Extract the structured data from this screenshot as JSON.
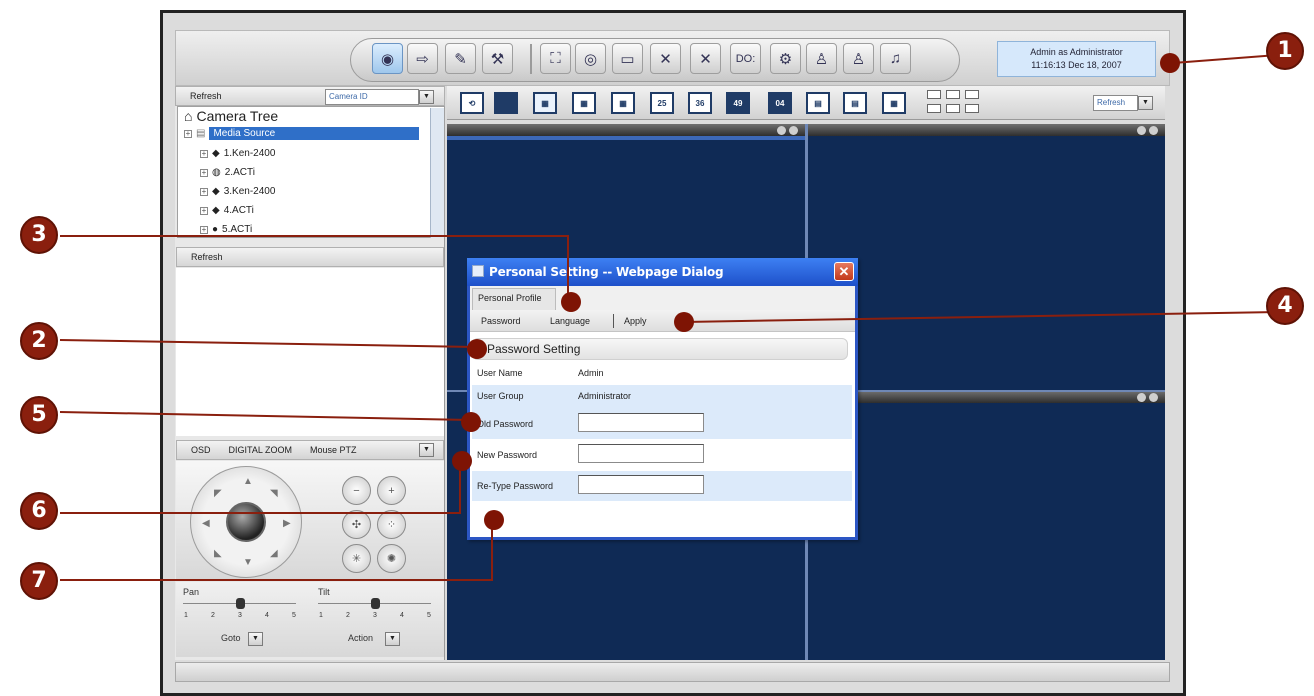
{
  "header": {
    "user_line": "Admin as Administrator",
    "time_line": "11:16:13 Dec 18, 2007",
    "toolbar": [
      {
        "icon": "eye-icon"
      },
      {
        "icon": "export-icon"
      },
      {
        "icon": "route-icon"
      },
      {
        "icon": "tools-icon"
      },
      {
        "icon": "fullscreen-icon"
      },
      {
        "icon": "snapshot-icon"
      },
      {
        "icon": "record-icon"
      },
      {
        "icon": "mute-video-icon"
      },
      {
        "icon": "mute-all-icon"
      },
      {
        "icon": "digital-output-icon",
        "label": "DO:"
      },
      {
        "icon": "settings-icon"
      },
      {
        "icon": "user-icon"
      },
      {
        "icon": "user-settings-icon"
      },
      {
        "icon": "audio-icon"
      }
    ]
  },
  "left": {
    "refresh_label": "Refresh",
    "camera_select": "Camera ID",
    "tree_title": "Camera Tree",
    "media_source": "Media Source",
    "cameras": [
      "1.Ken-2400",
      "2.ACTi",
      "3.Ken-2400",
      "4.ACTi",
      "5.ACTi"
    ],
    "refresh2_label": "Refresh",
    "ptz_tabs": [
      "OSD",
      "DIGITAL ZOOM",
      "Mouse PTZ"
    ],
    "pan_label": "Pan",
    "tilt_label": "Tilt",
    "pan_value": 3,
    "tilt_value": 3,
    "scale": [
      "1",
      "2",
      "3",
      "4",
      "5"
    ],
    "goto_label": "Goto",
    "action_label": "Action"
  },
  "layouts": {
    "buttons": [
      "cycle",
      "1",
      "4",
      "9",
      "16",
      "25",
      "36",
      "49",
      "04",
      "alt-a",
      "alt-b",
      "alt-c"
    ],
    "number_labels": {
      "b25": "25",
      "b36": "36",
      "b49": "49",
      "b04": "04"
    },
    "refresh_select": "Refresh"
  },
  "dialog": {
    "title": "Personal Setting -- Webpage Dialog",
    "tab": "Personal Profile",
    "menu": [
      "Password",
      "Language",
      "Apply"
    ],
    "section": "Password Setting",
    "fields": {
      "user_name_label": "User Name",
      "user_name_value": "Admin",
      "user_group_label": "User Group",
      "user_group_value": "Administrator",
      "old_password_label": "Old Password",
      "new_password_label": "New Password",
      "retype_password_label": "Re-Type Password"
    }
  },
  "callouts": [
    "1",
    "2",
    "3",
    "4",
    "5",
    "6",
    "7"
  ],
  "colors": {
    "callout": "#8a1f0e",
    "video_bg": "#0f2a55",
    "dialog_title": "#1e50c9",
    "selection": "#2f6fc8"
  }
}
